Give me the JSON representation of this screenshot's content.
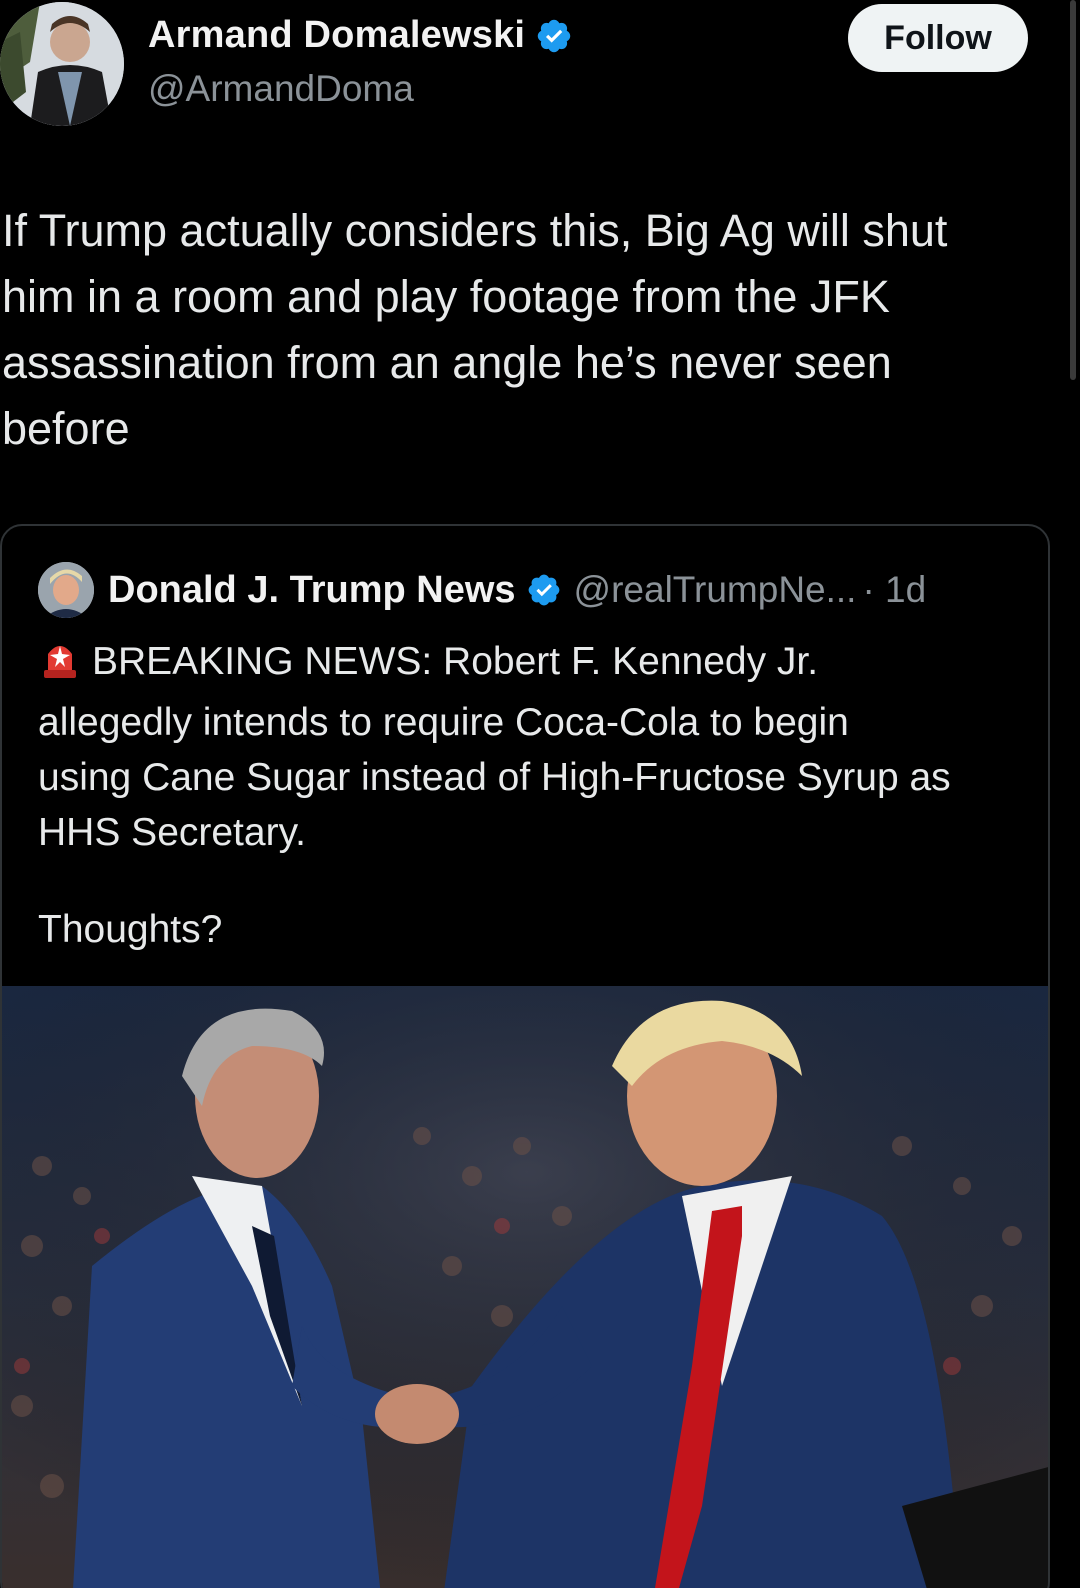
{
  "author": {
    "display_name": "Armand Domalewski",
    "handle": "@ArmandDoma",
    "verified": true
  },
  "follow_label": "Follow",
  "tweet": {
    "lines": [
      "If Trump actually considers this, Big Ag will shut",
      "him in a room and play footage from the JFK",
      "assassination from an angle he’s never seen",
      "before"
    ]
  },
  "quote": {
    "display_name": "Donald J. Trump News",
    "handle": "@realTrumpNe...",
    "time": "· 1d",
    "lines": [
      "BREAKING NEWS: Robert F. Kennedy Jr.",
      "allegedly intends to require Coca-Cola to begin",
      "using Cane Sugar instead of High-Fructose Syrup as",
      "HHS Secretary."
    ],
    "thoughts": "Thoughts?"
  },
  "colors": {
    "background": "#000000",
    "verified_badge": "#1d9bf0",
    "text_primary": "#e7e9ea",
    "text_secondary": "#8b9298",
    "card_border": "#2f3336"
  },
  "icons": {
    "verified": "verified-badge-icon",
    "siren": "siren-icon"
  }
}
